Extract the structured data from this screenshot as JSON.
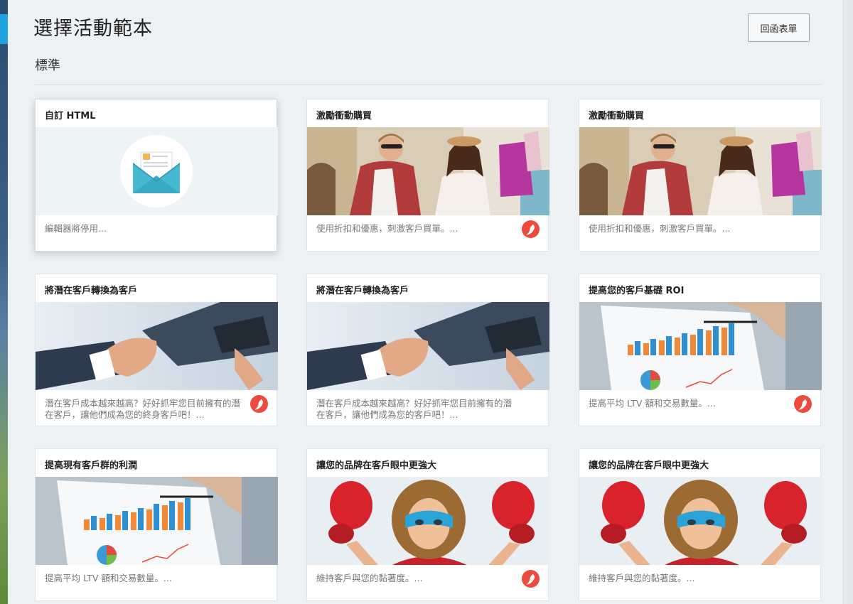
{
  "header": {
    "title": "選擇活動範本",
    "back_label": "回函表單"
  },
  "section": {
    "title": "標準"
  },
  "colors": {
    "accent": "#1fa3e0",
    "pepper_badge": "#ec4a3c"
  },
  "cards": [
    {
      "title": "自訂 HTML",
      "desc": "編輯器將停用...",
      "image": "envelope-icon",
      "pepper": false,
      "selected": true
    },
    {
      "title": "激勵衝動購買",
      "desc": "使用折扣和優惠，刺激客戶買單。...",
      "image": "shopping-couple",
      "pepper": true
    },
    {
      "title": "激勵衝動購買",
      "desc": "使用折扣和優惠，刺激客戶買單。...",
      "image": "shopping-couple",
      "pepper": false
    },
    {
      "title": "將潛在客戶轉換為客戶",
      "desc": "潛在客戶成本越來越高？好好抓牢您目前擁有的潛在客戶，讓他們成為您的終身客戶吧！...",
      "image": "handshake",
      "pepper": true
    },
    {
      "title": "將潛在客戶轉換為客戶",
      "desc": "潛在客戶成本越來越高？好好抓牢您目前擁有的潛在客戶，讓他們成為您的客戶吧！...",
      "image": "handshake",
      "pepper": false
    },
    {
      "title": "提高您的客戶基礎 ROI",
      "desc": "提高平均 LTV 額和交易數量。...",
      "image": "chart-report",
      "pepper": true
    },
    {
      "title": "提高現有客戶群的利潤",
      "desc": "提高平均 LTV 額和交易數量。...",
      "image": "chart-report",
      "pepper": false
    },
    {
      "title": "讓您的品牌在客戶眼中更強大",
      "desc": "維持客戶與您的黏著度。...",
      "image": "superhero-kid",
      "pepper": true
    },
    {
      "title": "讓您的品牌在客戶眼中更強大",
      "desc": "維持客戶與您的黏著度。...",
      "image": "superhero-kid",
      "pepper": false
    }
  ]
}
